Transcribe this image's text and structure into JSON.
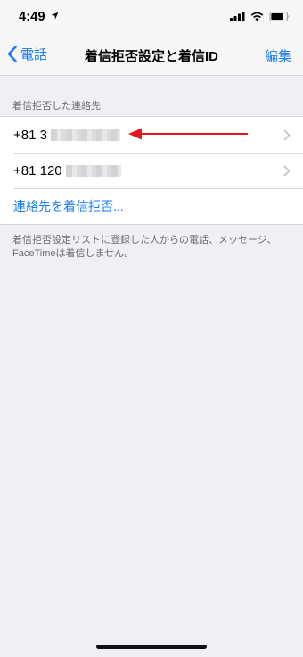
{
  "status": {
    "time": "4:49"
  },
  "nav": {
    "back_label": "電話",
    "title": "着信拒否設定と着信ID",
    "edit_label": "編集"
  },
  "section": {
    "header": "着信拒否した連絡先",
    "rows": [
      {
        "prefix": "+81 3"
      },
      {
        "prefix": "+81 120"
      }
    ],
    "add_link": "連絡先を着信拒否..."
  },
  "footer": "着信拒否設定リストに登録した人からの電話、メッセージ、FaceTimeは着信しません。",
  "colors": {
    "accent": "#1a7ef5",
    "annotation_arrow": "#e0171e"
  }
}
